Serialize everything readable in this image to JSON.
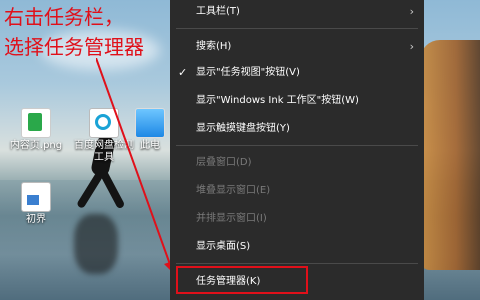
{
  "annotation": {
    "line1": "右击任务栏，",
    "line2": "选择任务管理器"
  },
  "desktop_icons": [
    {
      "label": "内容页.png",
      "icon": "png-file-icon"
    },
    {
      "label": "百度网盘检测工具",
      "icon": "baidu-tool-icon"
    },
    {
      "label": "此电",
      "icon": "this-pc-icon"
    },
    {
      "label": "初界",
      "icon": "document-icon"
    }
  ],
  "context_menu": {
    "items": {
      "toolbars": "工具栏(T)",
      "search": "搜索(H)",
      "task_view": "显示\"任务视图\"按钮(V)",
      "windows_ink": "显示\"Windows Ink 工作区\"按钮(W)",
      "touch_keyboard": "显示触摸键盘按钮(Y)",
      "cascade": "层叠窗口(D)",
      "stacked": "堆叠显示窗口(E)",
      "side_by_side": "并排显示窗口(I)",
      "show_desktop": "显示桌面(S)",
      "task_manager": "任务管理器(K)"
    },
    "chevron": "›",
    "check": "✓"
  },
  "colors": {
    "menu_bg": "#2b2b2b",
    "annotation_red": "#e0101a",
    "disabled_text": "#7a7a7a"
  }
}
